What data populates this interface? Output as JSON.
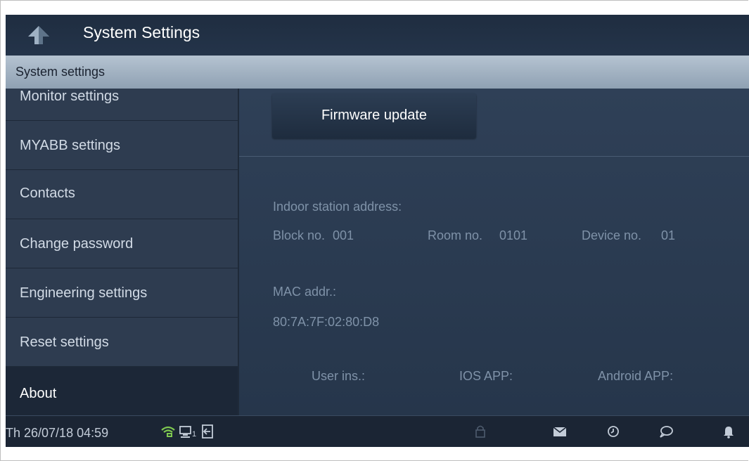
{
  "header": {
    "title": "System Settings"
  },
  "subheader": {
    "title": "System settings"
  },
  "sidebar": {
    "items": [
      {
        "label": "Monitor settings"
      },
      {
        "label": "MYABB settings"
      },
      {
        "label": "Contacts"
      },
      {
        "label": "Change password"
      },
      {
        "label": "Engineering settings"
      },
      {
        "label": "Reset settings"
      },
      {
        "label": "About"
      }
    ]
  },
  "main": {
    "firmware_button": "Firmware update",
    "address_label": "Indoor station address:",
    "block_label": "Block no.",
    "block_value": "001",
    "room_label": "Room no.",
    "room_value": "0101",
    "device_label": "Device no.",
    "device_value": "01",
    "mac_label": "MAC addr.:",
    "mac_value": "80:7A:7F:02:80:D8",
    "user_ins": "User ins.:",
    "ios_app": "IOS APP:",
    "android_app": "Android APP:"
  },
  "statusbar": {
    "datetime": "Th 26/07/18  04:59",
    "screen_index": "1",
    "icons": [
      "wifi-icon",
      "network-icon",
      "door-icon",
      "lock-icon",
      "mail-icon",
      "history-icon",
      "chat-icon",
      "bell-icon"
    ]
  },
  "colors": {
    "accent": "#2b3a4e",
    "subheader": "#a7b6c6",
    "status_green": "#7ec850"
  }
}
